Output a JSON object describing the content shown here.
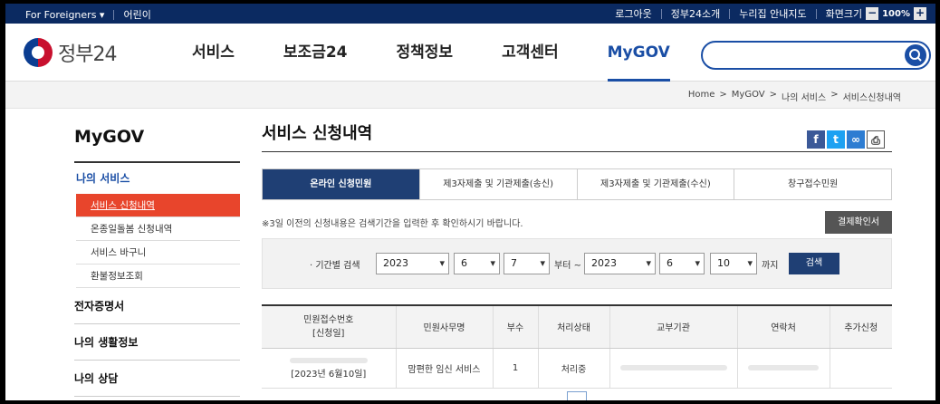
{
  "topbar": {
    "lang": "For Foreigners",
    "kids": "어린이",
    "login": "로그아웃",
    "about": "정부24소개",
    "sitemap": "누리집 안내지도",
    "zoom_label": "화면크기",
    "zoom_minus": "−",
    "zoom_value": "100%",
    "zoom_plus": "+"
  },
  "header": {
    "logo_text": "정부24",
    "nav": [
      {
        "label": "서비스"
      },
      {
        "label": "보조금24"
      },
      {
        "label": "정책정보"
      },
      {
        "label": "고객센터"
      },
      {
        "label": "MyGOV"
      }
    ],
    "active_nav": "MyGOV",
    "search_placeholder": ""
  },
  "breadcrumb": [
    "Home",
    "MyGOV",
    "나의 서비스",
    "서비스신청내역"
  ],
  "breadcrumb_sep": ">",
  "sidebar": {
    "title": "MyGOV",
    "section": "나의 서비스",
    "items": [
      {
        "label": "서비스 신청내역"
      },
      {
        "label": "온종일돌봄 신청내역"
      },
      {
        "label": "서비스 바구니"
      },
      {
        "label": "환불정보조회"
      }
    ],
    "groups": [
      {
        "label": "전자증명서"
      },
      {
        "label": "나의 생활정보"
      },
      {
        "label": "나의 상담"
      }
    ]
  },
  "content": {
    "title": "서비스 신청내역",
    "share_icons": [
      "facebook-icon",
      "twitter-icon",
      "link-icon",
      "print-icon"
    ],
    "tabs": [
      {
        "label": "온라인 신청민원"
      },
      {
        "label": "제3자제출 및 기관제출(송신)"
      },
      {
        "label": "제3자제출 및 기관제출(수신)"
      },
      {
        "label": "창구접수민원"
      }
    ],
    "notice": "※3일 이전의 신청내용은 검색기간을 입력한 후 확인하시기 바랍니다.",
    "confirm_button": "결제확인서",
    "filter": {
      "label": "· 기간별 검색",
      "from_year": "2023",
      "from_month": "6",
      "from_day": "7",
      "from_suffix": "부터 ~",
      "to_year": "2023",
      "to_month": "6",
      "to_day": "10",
      "to_suffix": "까지",
      "search_button": "검색"
    },
    "table": {
      "headers": [
        "민원접수번호\n[신청일]",
        "민원사무명",
        "부수",
        "처리상태",
        "교부기관",
        "연락처",
        "추가신청"
      ],
      "rows": [
        {
          "receipt_date": "[2023년 6월10일]",
          "service": "맘편한 임신 서비스",
          "copies": "1",
          "status": "처리중"
        }
      ]
    }
  },
  "colors": {
    "navy": "#0b2a61",
    "accent": "#1a4ea5",
    "active_item": "#e8452c",
    "tab_active": "#1f3f74"
  }
}
